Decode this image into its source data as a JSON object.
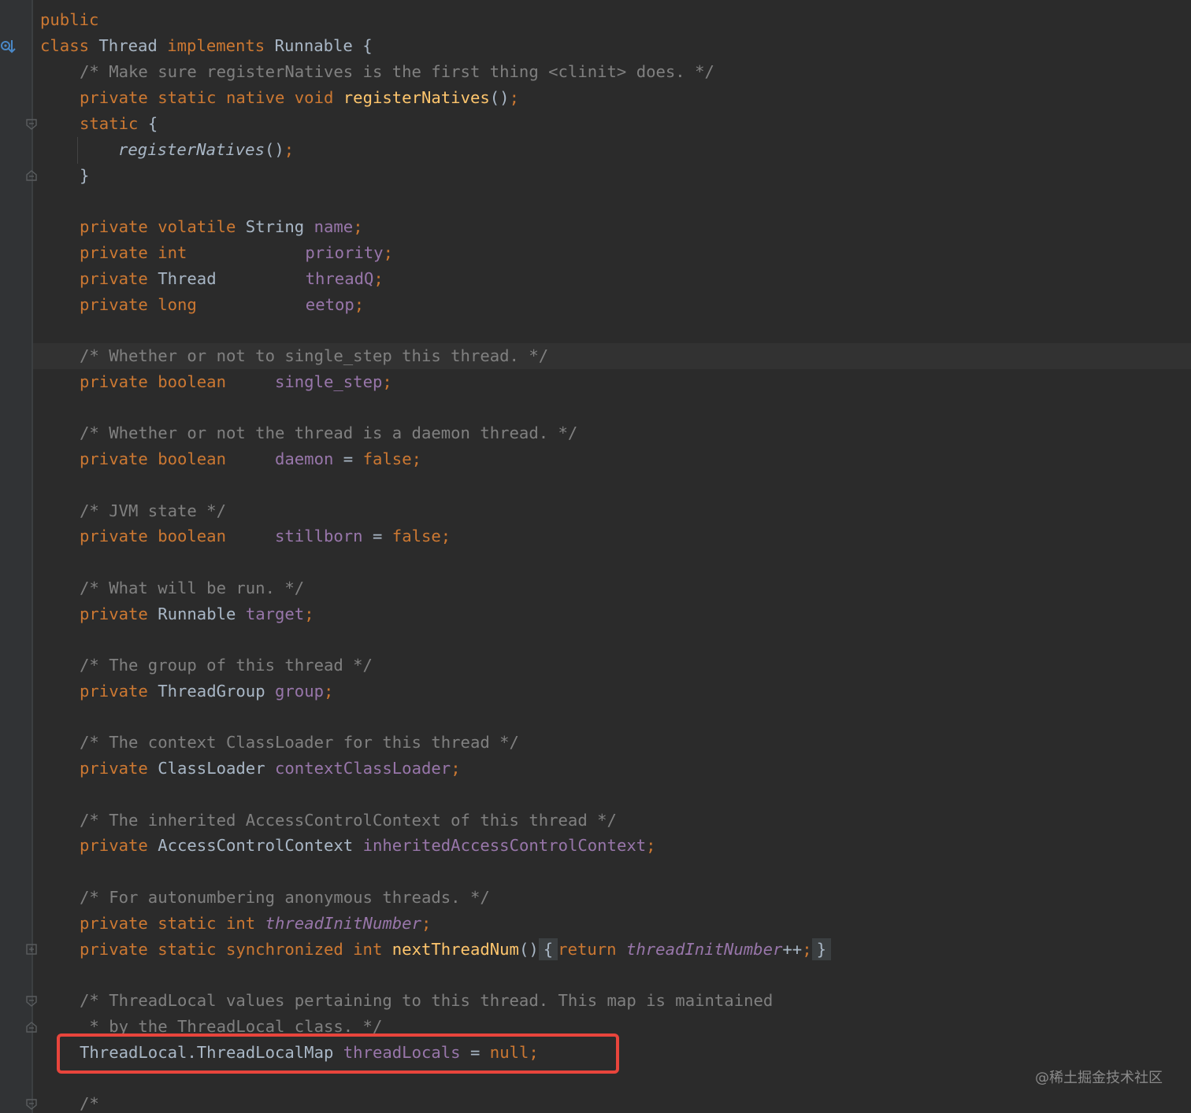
{
  "editor": {
    "lines": [
      {
        "t1": "public"
      },
      {
        "kw1": "class",
        "ty1": "Thread",
        "kw2": "implements",
        "ty2": "Runnable {"
      },
      {
        "cm": "/* Make sure registerNatives is the first thing <clinit> does. */"
      },
      {
        "kw": "private static native void",
        "fn": "registerNatives",
        "p": "()",
        "sc": ";"
      },
      {
        "kw": "static",
        "p": "{"
      },
      {
        "fn": "registerNatives",
        "p": "()",
        "sc": ";"
      },
      {
        "p": "}"
      },
      {
        "kw": "private volatile",
        "ty": "String",
        "fld": "name",
        "sc": ";"
      },
      {
        "kw": "private int",
        "fld": "priority",
        "sc": ";"
      },
      {
        "kw": "private",
        "ty": "Thread",
        "fld": "threadQ",
        "sc": ";"
      },
      {
        "kw": "private long",
        "fld": "eetop",
        "sc": ";"
      },
      {
        "cm": "/* Whether or not to single_step this thread. */"
      },
      {
        "kw": "private boolean",
        "fld": "single_step",
        "sc": ";"
      },
      {
        "cm": "/* Whether or not the thread is a daemon thread. */"
      },
      {
        "kw": "private boolean",
        "fld": "daemon",
        "p": "=",
        "kw2": "false",
        "sc": ";"
      },
      {
        "cm": "/* JVM state */"
      },
      {
        "kw": "private boolean",
        "fld": "stillborn",
        "p": "=",
        "kw2": "false",
        "sc": ";"
      },
      {
        "cm": "/* What will be run. */"
      },
      {
        "kw": "private",
        "ty": "Runnable",
        "fld": "target",
        "sc": ";"
      },
      {
        "cm": "/* The group of this thread */"
      },
      {
        "kw": "private",
        "ty": "ThreadGroup",
        "fld": "group",
        "sc": ";"
      },
      {
        "cm": "/* The context ClassLoader for this thread */"
      },
      {
        "kw": "private",
        "ty": "ClassLoader",
        "fld": "contextClassLoader",
        "sc": ";"
      },
      {
        "cm": "/* The inherited AccessControlContext of this thread */"
      },
      {
        "kw": "private",
        "ty": "AccessControlContext",
        "fld": "inheritedAccessControlContext",
        "sc": ";"
      },
      {
        "cm": "/* For autonumbering anonymous threads. */"
      },
      {
        "kw": "private static int",
        "fld": "threadInitNumber",
        "sc": ";"
      },
      {
        "kw": "private static synchronized int",
        "fn": "nextThreadNum",
        "p": "()",
        "b1": "{",
        "kw2": "return",
        "fld": "threadInitNumber",
        "p2": "++",
        "sc": ";",
        "b2": "}"
      },
      {
        "cm": "/* ThreadLocal values pertaining to this thread. This map is maintained"
      },
      {
        "cm": " * by the ThreadLocal class. */"
      },
      {
        "ty": "ThreadLocal.ThreadLocalMap",
        "fld": "threadLocals",
        "p": "=",
        "kw2": "null",
        "sc": ";"
      },
      {
        "cm": "/*"
      }
    ]
  },
  "watermark": "@稀土掘金技术社区",
  "colors": {
    "background": "#2b2b2b",
    "keyword": "#cc7832",
    "comment": "#808080",
    "field": "#9876aa",
    "method": "#ffc66d",
    "plain": "#a9b7c6",
    "highlight_box": "#e8453c"
  },
  "icons": [
    "implemented-method-icon",
    "fold-icon"
  ]
}
